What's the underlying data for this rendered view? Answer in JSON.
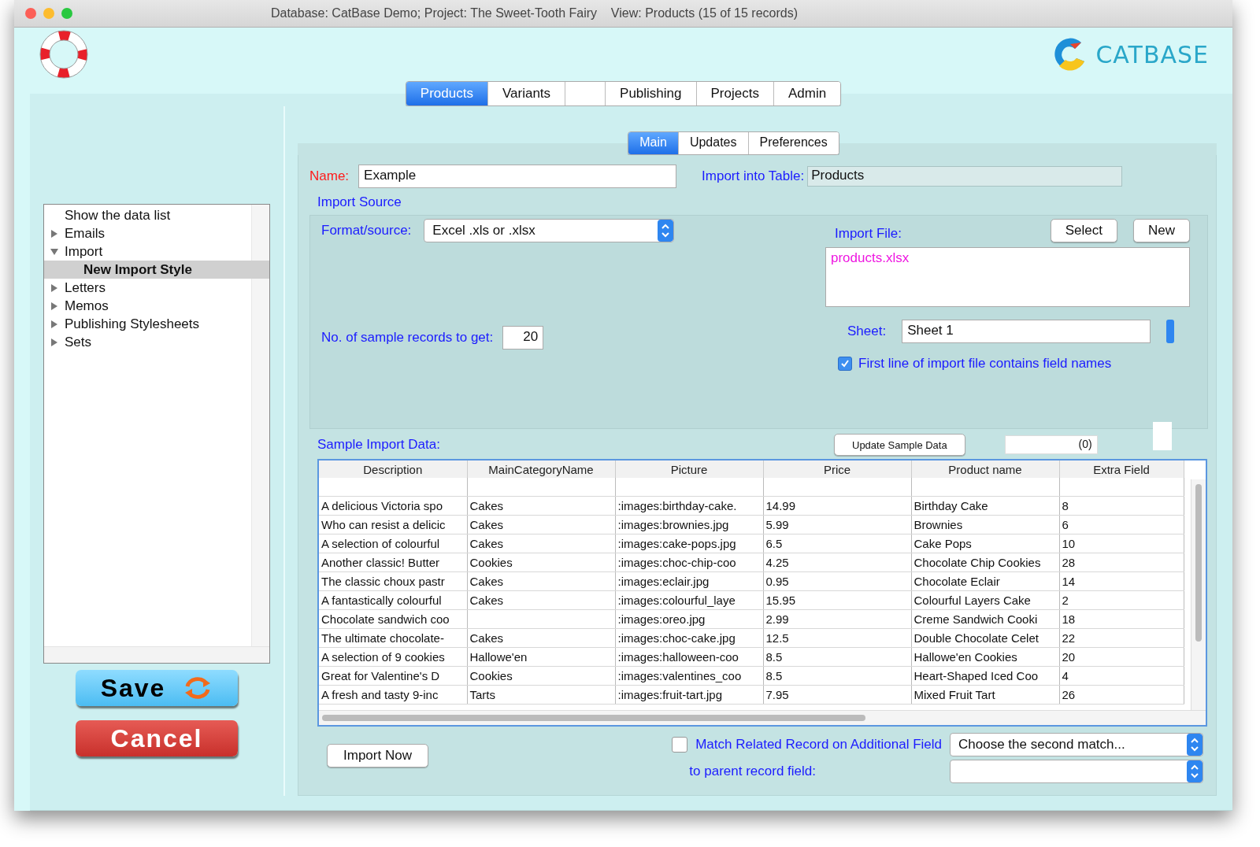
{
  "window": {
    "title": "Database: CatBase Demo; Project: The Sweet-Tooth Fairy    View: Products (15 of 15 records)"
  },
  "logo": {
    "text": "CATBASE"
  },
  "main_tabs": [
    {
      "label": "Products",
      "selected": true
    },
    {
      "label": "Variants",
      "selected": false
    },
    {
      "kind": "blank",
      "selected": false
    },
    {
      "label": "Publishing",
      "selected": false
    },
    {
      "label": "Projects",
      "selected": false
    },
    {
      "label": "Admin",
      "selected": false
    }
  ],
  "sidebar": {
    "items": [
      {
        "kind": "item",
        "label": "Show the data list",
        "selected": false
      },
      {
        "kind": "group",
        "label": "Emails",
        "expanded": false,
        "selected": false
      },
      {
        "kind": "group",
        "label": "Import",
        "expanded": true,
        "selected": false,
        "children": [
          {
            "kind": "item",
            "label": "New Import Style",
            "selected": true
          }
        ]
      },
      {
        "kind": "group",
        "label": "Letters",
        "expanded": false,
        "selected": false
      },
      {
        "kind": "group",
        "label": "Memos",
        "expanded": false,
        "selected": false
      },
      {
        "kind": "group",
        "label": "Publishing Stylesheets",
        "expanded": false,
        "selected": false
      },
      {
        "kind": "group",
        "label": "Sets",
        "expanded": false,
        "selected": false
      }
    ]
  },
  "save_button": "Save",
  "cancel_button": "Cancel",
  "sub_tabs": [
    {
      "label": "Main",
      "selected": true
    },
    {
      "label": "Updates",
      "selected": false
    },
    {
      "label": "Preferences",
      "selected": false
    }
  ],
  "form": {
    "name_label": "Name:",
    "name_value": "Example",
    "table_label": "Import into Table:",
    "table_value": "Products"
  },
  "import_source": {
    "title": "Import Source",
    "format_label": "Format/source:",
    "format_value": "Excel .xls or .xlsx",
    "sample_label": "No. of sample records to get:",
    "sample_value": "20",
    "file_label": "Import File:",
    "file_buttons": [
      "Select",
      "New"
    ],
    "file_value": "products.xlsx",
    "sheet_label": "Sheet:",
    "sheet_value": "Sheet 1",
    "first_line": {
      "label": "First line of import file contains field names",
      "checked": true
    }
  },
  "sample": {
    "title": "Sample Import Data:",
    "update_button": "Update Sample Data",
    "count": "(0)"
  },
  "table": {
    "columns": [
      "Description",
      "MainCategoryName",
      "Picture",
      "Price",
      "Product name",
      "Extra Field"
    ],
    "rows": [
      {
        "description": "A delicious Victoria spo",
        "category": "Cakes",
        "picture": ":images:birthday-cake.",
        "price": "14.99",
        "product": "Birthday Cake",
        "extra": "8"
      },
      {
        "description": "Who can resist a delicic",
        "category": "Cakes",
        "picture": ":images:brownies.jpg",
        "price": "5.99",
        "product": "Brownies",
        "extra": "6"
      },
      {
        "description": "A selection of colourful",
        "category": "Cakes",
        "picture": ":images:cake-pops.jpg",
        "price": "6.5",
        "product": "Cake Pops",
        "extra": "10"
      },
      {
        "description": "Another classic! Butter",
        "category": "Cookies",
        "picture": ":images:choc-chip-coo",
        "price": "4.25",
        "product": "Chocolate Chip Cookies",
        "extra": "28"
      },
      {
        "description": "The classic choux pastr",
        "category": "Cakes",
        "picture": ":images:eclair.jpg",
        "price": "0.95",
        "product": "Chocolate Eclair",
        "extra": "14"
      },
      {
        "description": "A fantastically colourful",
        "category": "Cakes",
        "picture": ":images:colourful_laye",
        "price": "15.95",
        "product": "Colourful Layers Cake",
        "extra": "2"
      },
      {
        "description": "Chocolate sandwich coo",
        "picture": ":images:oreo.jpg",
        "price": "2.99",
        "product": "Creme Sandwich Cooki",
        "extra": "18"
      },
      {
        "description": "The ultimate chocolate-",
        "category": "Cakes",
        "picture": ":images:choc-cake.jpg",
        "price": "12.5",
        "product": "Double Chocolate Celet",
        "extra": "22"
      },
      {
        "description": "A selection of 9 cookies",
        "category": "Hallowe'en",
        "picture": ":images:halloween-coo",
        "price": "8.5",
        "product": "Hallowe'en Cookies",
        "extra": "20"
      },
      {
        "description": "Great for Valentine's D",
        "category": "Cookies",
        "picture": ":images:valentines_coo",
        "price": "8.5",
        "product": "Heart-Shaped Iced Coo",
        "extra": "4"
      },
      {
        "description": "A fresh and tasty 9-inc",
        "category": "Tarts",
        "picture": ":images:fruit-tart.jpg",
        "price": "7.95",
        "product": "Mixed Fruit Tart",
        "extra": "26"
      }
    ]
  },
  "bottom": {
    "import_button": "Import Now",
    "match": {
      "label": "Match Related Record on Additional Field",
      "checked": false
    },
    "match_value": "Choose the second match...",
    "parent_label": "to parent record field:"
  }
}
